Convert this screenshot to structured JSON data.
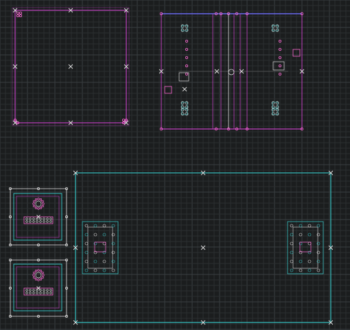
{
  "app": {
    "view": "cad-drawing-viewport"
  },
  "colors": {
    "background": "#1b1d1e",
    "grid_minor": "#2b2e30",
    "grid_major": "#3a3e41",
    "magenta": "#c040c0",
    "cyan": "#36c0c0",
    "white": "#e0e0e0",
    "blue": "#6a6af0",
    "pink": "#ff6ad5"
  },
  "drawing": {
    "layers": [
      "outline",
      "keepout",
      "pads",
      "snap-points"
    ],
    "objects": [
      {
        "id": "board-square-magenta",
        "kind": "outline",
        "color": "magenta"
      },
      {
        "id": "board-fan-assembly",
        "kind": "outline",
        "color": "magenta"
      },
      {
        "id": "module-small-top",
        "kind": "module",
        "color": "cyan"
      },
      {
        "id": "module-small-bottom",
        "kind": "module",
        "color": "cyan"
      },
      {
        "id": "board-large-cyan",
        "kind": "outline",
        "color": "cyan"
      }
    ]
  }
}
